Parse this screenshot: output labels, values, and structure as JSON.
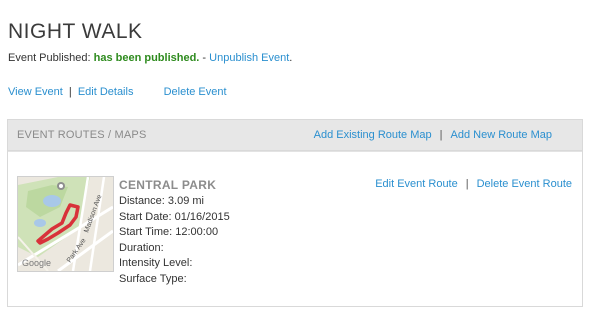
{
  "page": {
    "title": "NIGHT WALK"
  },
  "status": {
    "label": "Event Published:",
    "value": "has been published.",
    "separator": " - ",
    "unpublish_link": "Unpublish Event",
    "trailing": "."
  },
  "actions": {
    "view": "View Event",
    "separator": "|",
    "edit": "Edit Details",
    "delete": "Delete Event"
  },
  "routes": {
    "header_title": "EVENT ROUTES / MAPS",
    "add_existing": "Add Existing Route Map",
    "header_separator": "|",
    "add_new": "Add New Route Map",
    "items": [
      {
        "name": "CENTRAL PARK",
        "distance_label": "Distance:",
        "distance_value": "3.09 mi",
        "start_date_label": "Start Date:",
        "start_date_value": "01/16/2015",
        "start_time_label": "Start Time:",
        "start_time_value": "12:00:00",
        "duration_label": "Duration:",
        "intensity_label": "Intensity Level:",
        "surface_label": "Surface Type:",
        "edit_link": "Edit Event Route",
        "link_separator": "|",
        "delete_link": "Delete Event Route",
        "map": {
          "street_labels": [
            "Park Ave",
            "Madison Ave"
          ],
          "logo_text": "Google",
          "route_color": "#d8323a"
        }
      }
    ]
  },
  "colors": {
    "link": "#2a8fcf",
    "published": "#2e8b1e",
    "header_bg": "#e7e7e7"
  }
}
